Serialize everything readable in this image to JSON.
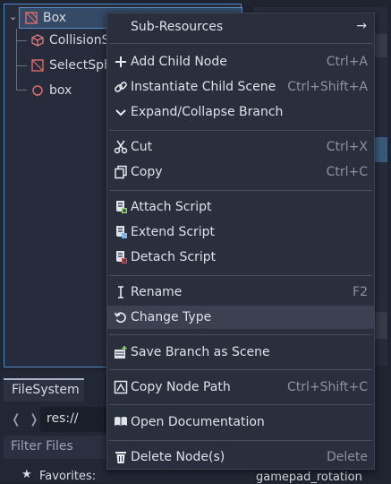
{
  "scene_tree": {
    "nodes": [
      {
        "label": "Box",
        "icon": "mesh-node-icon",
        "color": "#e06c6c"
      },
      {
        "label": "CollisionS",
        "icon": "collision-shape-icon",
        "color": "#e07a7a"
      },
      {
        "label": "SelectSph",
        "icon": "select-sphere-icon",
        "color": "#e06c6c"
      },
      {
        "label": "box",
        "icon": "circle-node-icon",
        "color": "#e06c6c"
      }
    ]
  },
  "filesystem": {
    "tab_label": "FileSystem",
    "path": "res://",
    "filter_placeholder": "Filter Files",
    "favorites_label": "Favorites:"
  },
  "inspector": {
    "bottom_text": "gamepad_rotation"
  },
  "context_menu": {
    "items": [
      {
        "label": "Sub-Resources",
        "shortcut": "",
        "icon": "none",
        "submenu": true
      },
      {
        "label": "Add Child Node",
        "shortcut": "Ctrl+A",
        "icon": "plus-icon"
      },
      {
        "label": "Instantiate Child Scene",
        "shortcut": "Ctrl+Shift+A",
        "icon": "link-icon"
      },
      {
        "label": "Expand/Collapse Branch",
        "shortcut": "",
        "icon": "chevron-down-icon"
      },
      {
        "label": "Cut",
        "shortcut": "Ctrl+X",
        "icon": "scissors-icon"
      },
      {
        "label": "Copy",
        "shortcut": "Ctrl+C",
        "icon": "copy-icon"
      },
      {
        "label": "Attach Script",
        "shortcut": "",
        "icon": "script-add-icon"
      },
      {
        "label": "Extend Script",
        "shortcut": "",
        "icon": "script-extend-icon"
      },
      {
        "label": "Detach Script",
        "shortcut": "",
        "icon": "script-remove-icon"
      },
      {
        "label": "Rename",
        "shortcut": "F2",
        "icon": "text-cursor-icon"
      },
      {
        "label": "Change Type",
        "shortcut": "",
        "icon": "rotate-icon"
      },
      {
        "label": "Save Branch as Scene",
        "shortcut": "",
        "icon": "save-scene-icon"
      },
      {
        "label": "Copy Node Path",
        "shortcut": "Ctrl+Shift+C",
        "icon": "node-path-icon"
      },
      {
        "label": "Open Documentation",
        "shortcut": "",
        "icon": "docs-icon"
      },
      {
        "label": "Delete Node(s)",
        "shortcut": "Delete",
        "icon": "trash-icon"
      }
    ]
  },
  "colors": {
    "menu_bg": "#2a2f3d",
    "hover_bg": "#3b4150",
    "accent": "#4e88c4",
    "script_green": "#8fd16a",
    "script_red": "#e05555"
  }
}
